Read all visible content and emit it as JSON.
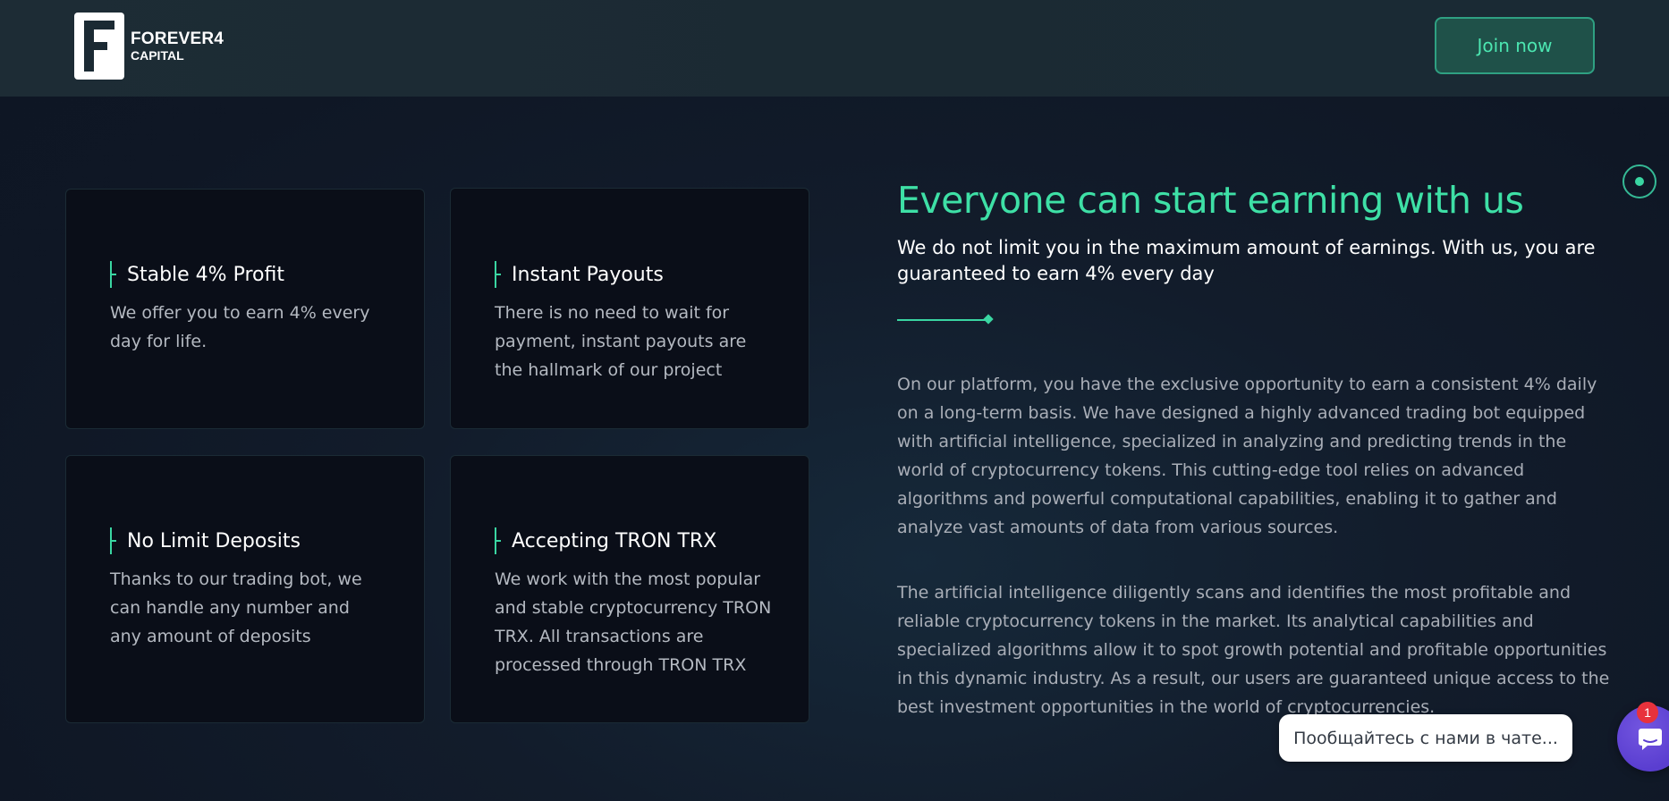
{
  "header": {
    "logo_line1": "FOREVER4",
    "logo_line2": "CAPITAL",
    "join_label": "Join now"
  },
  "features": [
    {
      "title": "Stable 4% Profit",
      "text": "We offer you to earn 4% every day for life."
    },
    {
      "title": "Instant Payouts",
      "text": "There is no need to wait for payment, instant payouts are the hallmark of our project"
    },
    {
      "title": "No Limit Deposits",
      "text": "Thanks to our trading bot, we can handle any number and any amount of deposits"
    },
    {
      "title": "Accepting TRON TRX",
      "text": "We work with the most popular and stable cryptocurrency TRON TRX. All transactions are processed through TRON TRX"
    }
  ],
  "main": {
    "headline": "Everyone can start earning with us",
    "subheadline": "We do not limit you in the maximum amount of earnings. With us, you are guaranteed to earn 4% every day",
    "paragraphs": [
      "On our platform, you have the exclusive opportunity to earn a consistent 4% daily on a long-term basis. We have designed a highly advanced trading bot equipped with artificial intelligence, specialized in analyzing and predicting trends in the world of cryptocurrency tokens. This cutting-edge tool relies on advanced algorithms and powerful computational capabilities, enabling it to gather and analyze vast amounts of data from various sources.",
      "The artificial intelligence diligently scans and identifies the most profitable and reliable cryptocurrency tokens in the market. Its analytical capabilities and specialized algorithms allow it to spot growth potential and profitable opportunities in this dynamic industry. As a result, our users are guaranteed unique access to the best investment opportunities in the world of cryptocurrencies."
    ]
  },
  "chat": {
    "prompt": "Пообщайтесь с нами в чате...",
    "badge_count": "1",
    "icon": "chat-icon"
  },
  "colors": {
    "accent": "#3ee0a6",
    "card_bg": "#0a0e18",
    "chat_purple": "#5a3ed0",
    "badge_red": "#e8323c"
  }
}
